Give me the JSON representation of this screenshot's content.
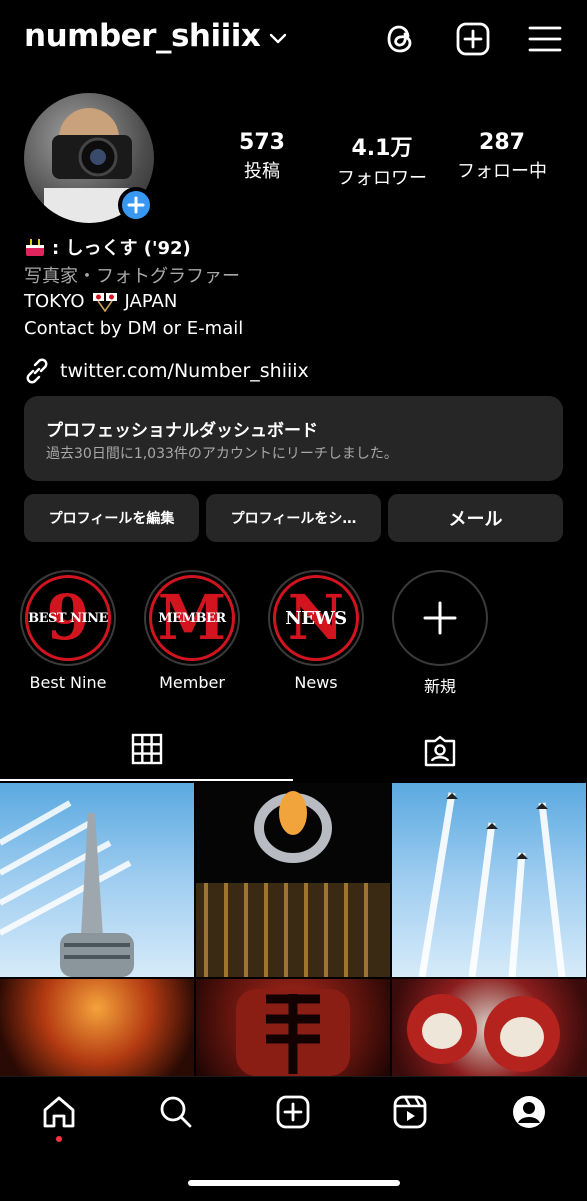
{
  "header": {
    "username": "number_shiiix",
    "icons": [
      "chevron-down-icon",
      "threads-icon",
      "add-post-icon",
      "menu-icon"
    ]
  },
  "profile": {
    "stats": [
      {
        "value": "573",
        "label": "投稿"
      },
      {
        "value": "4.1万",
        "label": "フォロワー"
      },
      {
        "value": "287",
        "label": "フォロー中"
      }
    ],
    "name": ": しっくす ('92)",
    "category": "写真家・フォトグラファー",
    "bio_line1_a": "TOKYO",
    "bio_line1_b": "JAPAN",
    "bio_line2": "Contact by DM or E-mail",
    "link": "twitter.com/Number_shiiix"
  },
  "dashboard": {
    "title": "プロフェッショナルダッシュボード",
    "subtitle": "過去30日間に1,033件のアカウントにリーチしました。"
  },
  "buttons": {
    "edit": "プロフィールを編集",
    "share": "プロフィールをシ…",
    "mail": "メール"
  },
  "highlights": [
    {
      "cover_big": "9",
      "cover_text": "BEST NINE",
      "label": "Best Nine"
    },
    {
      "cover_big": "M",
      "cover_text": "MEMBER",
      "label": "Member"
    },
    {
      "cover_big": "N",
      "cover_text": "NEWS",
      "label": "News"
    },
    {
      "label": "新規"
    }
  ],
  "tabs": [
    "grid-icon",
    "tagged-icon"
  ],
  "colors": {
    "accent_blue": "#3897f0",
    "surface": "#262626",
    "highlight_red": "#d2141f",
    "notification_dot": "#ff3040"
  },
  "nav": [
    "home-icon",
    "search-icon",
    "create-icon",
    "reels-icon",
    "profile-icon"
  ]
}
